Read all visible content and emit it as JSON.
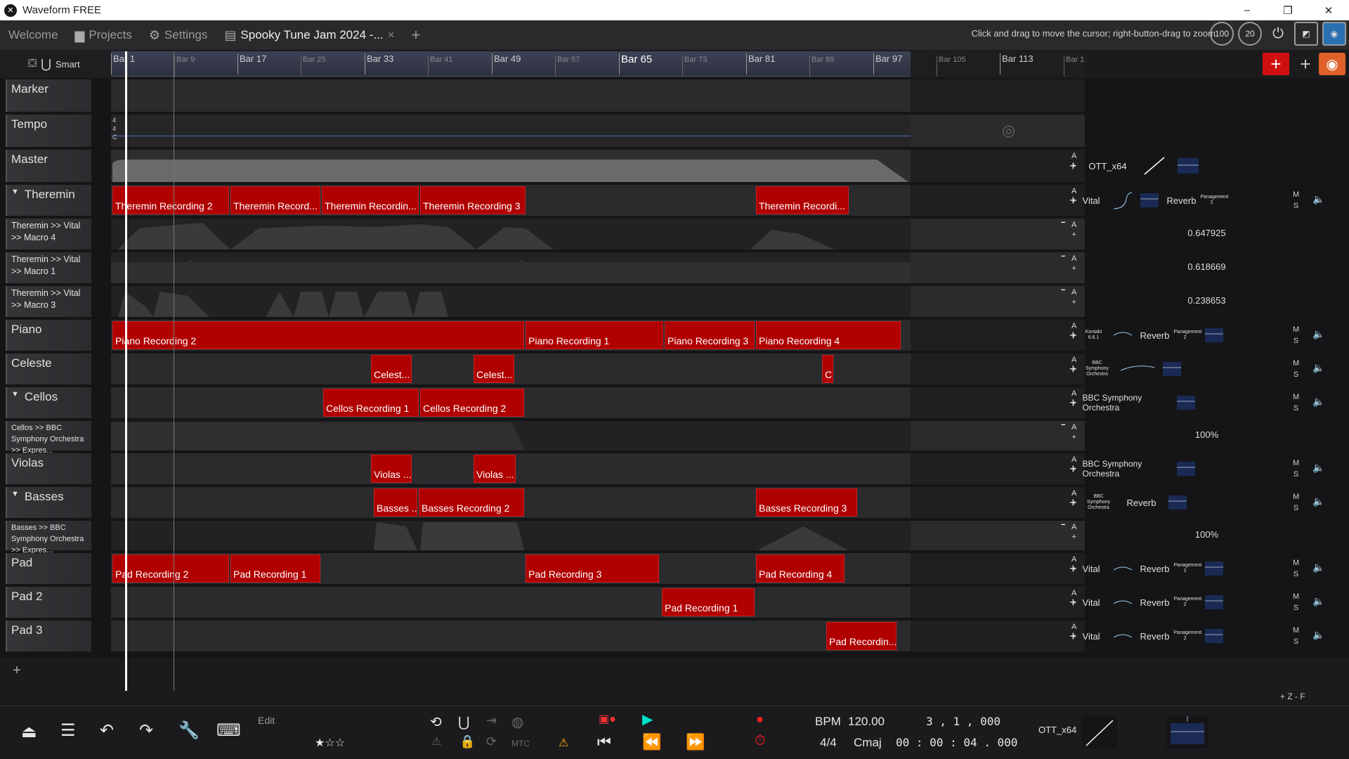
{
  "window": {
    "title": "Waveform FREE",
    "icon": "waveform-logo-icon",
    "min": "–",
    "max": "❐",
    "close": "✕"
  },
  "tabs": [
    {
      "label": "Welcome",
      "icon": ""
    },
    {
      "label": "Projects",
      "icon": "folder-icon"
    },
    {
      "label": "Settings",
      "icon": "gear-icon"
    },
    {
      "label": "Spooky Tune Jam 2024 -...",
      "icon": "edit-icon",
      "close": "×"
    }
  ],
  "new_tab": "+",
  "hint": "Click and drag to move the cursor; right-button-drag to zoom",
  "toolbar_icons": {
    "zoom_a": "100",
    "zoom_b": "20"
  },
  "snap": {
    "label": "Smart"
  },
  "ruler": {
    "bars": [
      "Bar 1",
      "Bar 9",
      "Bar 17",
      "Bar 25",
      "Bar 33",
      "Bar 41",
      "Bar 49",
      "Bar 57",
      "Bar 65",
      "Bar 73",
      "Bar 81",
      "Bar 89",
      "Bar 97",
      "Bar 105",
      "Bar 113",
      "Bar 1"
    ]
  },
  "tempo_sig": [
    "4",
    "4",
    "C"
  ],
  "tracks": [
    {
      "name": "Marker"
    },
    {
      "name": "Tempo"
    },
    {
      "name": "Master",
      "plugin": "OTT_x64"
    },
    {
      "name": "Theremin",
      "clips": [
        "Theremin Recording 2",
        "Theremin Record...",
        "Theremin Recordin...",
        "Theremin Recording 3",
        "Theremin Recordi..."
      ],
      "plugins": [
        "Vital",
        "Reverb"
      ],
      "sub": "Panagement 2"
    },
    {
      "name": "Theremin >> Vital >> Macro 4",
      "value": "0.647925"
    },
    {
      "name": "Theremin >> Vital >> Macro 1",
      "value": "0.618669"
    },
    {
      "name": "Theremin >> Vital >> Macro 3",
      "value": "0.238653"
    },
    {
      "name": "Piano",
      "clips": [
        "Piano Recording 2",
        "Piano Recording 1",
        "Piano Recording 3",
        "Piano Recording 4"
      ],
      "plugins": [
        "Kontakt 6.6.1",
        "Reverb"
      ],
      "sub": "Panagement 2"
    },
    {
      "name": "Celeste",
      "clips": [
        "Celest...",
        "Celest...",
        "C"
      ],
      "plugins": [
        "BBC Symphony Orchestra"
      ]
    },
    {
      "name": "Cellos",
      "clips": [
        "Cellos Recording 1",
        "Cellos Recording 2"
      ],
      "plugins": [
        "BBC Symphony Orchestra"
      ]
    },
    {
      "name": "Cellos >> BBC Symphony Orchestra >> Expres...",
      "value": "100%"
    },
    {
      "name": "Violas",
      "clips": [
        "Violas ...",
        "Violas ..."
      ],
      "plugins": [
        "BBC Symphony Orchestra"
      ]
    },
    {
      "name": "Basses",
      "clips": [
        "Basses ...",
        "Basses Recording 2",
        "Basses Recording 3"
      ],
      "plugins": [
        "BBC Symphony Orchestra",
        "Reverb"
      ]
    },
    {
      "name": "Basses >> BBC Symphony Orchestra >> Expres...",
      "value": "100%"
    },
    {
      "name": "Pad",
      "clips": [
        "Pad Recording 2",
        "Pad Recording 1",
        "Pad Recording 3",
        "Pad Recording 4"
      ],
      "plugins": [
        "Vital",
        "Reverb"
      ],
      "sub": "Panagement 2"
    },
    {
      "name": "Pad 2",
      "clips": [
        "Pad Recording 1"
      ],
      "plugins": [
        "Vital",
        "Reverb"
      ],
      "sub": "Panagement 2"
    },
    {
      "name": "Pad 3",
      "clips": [
        "Pad Recordin..."
      ],
      "plugins": [
        "Vital",
        "Reverb"
      ],
      "sub": "Panagement 2"
    }
  ],
  "ms": {
    "m": "M",
    "s": "S",
    "a": "A",
    "plus": "+",
    "minus": "−"
  },
  "add_track": "+",
  "bottom": {
    "edit": "Edit",
    "bpm_label": "BPM",
    "bpm": "120.00",
    "position": "3 , 1 , 000",
    "time_sig": "4/4",
    "key": "Cmaj",
    "time": "00 : 00 : 04 . 000",
    "master_plugin": "OTT_x64",
    "mtc": "MTC",
    "zoom_hint": "+ Z - F"
  },
  "colors": {
    "clip": "#b00000",
    "teal": "#00c4b0",
    "record": "#ff2020"
  }
}
